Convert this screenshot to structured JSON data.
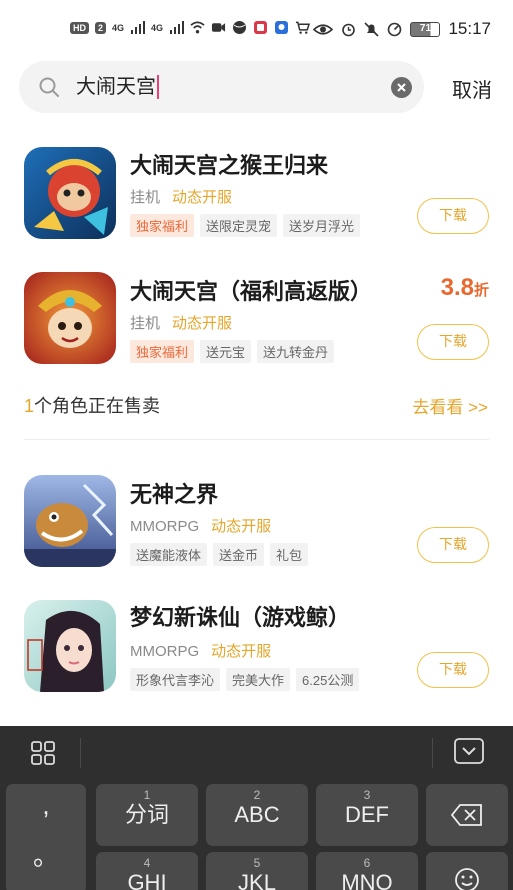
{
  "status_bar": {
    "hd_badge": "HD",
    "sim1": "2",
    "net1": "4G",
    "net2": "4G",
    "battery": "71",
    "time": "15:17"
  },
  "search": {
    "query": "大闹天宫",
    "cancel_label": "取消"
  },
  "apps": [
    {
      "title": "大闹天宫之猴王归来",
      "category": "挂机",
      "open_status": "动态开服",
      "tags": [
        {
          "text": "独家福利",
          "hot": true
        },
        {
          "text": "送限定灵宠",
          "hot": false
        },
        {
          "text": "送岁月浮光",
          "hot": false
        }
      ],
      "download_label": "下载",
      "discount_num": "",
      "discount_unit": ""
    },
    {
      "title": "大闹天宫（福利高返版）",
      "category": "挂机",
      "open_status": "动态开服",
      "tags": [
        {
          "text": "独家福利",
          "hot": true
        },
        {
          "text": "送元宝",
          "hot": false
        },
        {
          "text": "送九转金丹",
          "hot": false
        }
      ],
      "download_label": "下载",
      "discount_num": "3.8",
      "discount_unit": "折"
    },
    {
      "title": "无神之界",
      "category": "MMORPG",
      "open_status": "动态开服",
      "tags": [
        {
          "text": "送魔能液体",
          "hot": false
        },
        {
          "text": "送金币",
          "hot": false
        },
        {
          "text": "礼包",
          "hot": false
        }
      ],
      "download_label": "下载",
      "discount_num": "",
      "discount_unit": ""
    },
    {
      "title": "梦幻新诛仙（游戏鲸）",
      "category": "MMORPG",
      "open_status": "动态开服",
      "tags": [
        {
          "text": "形象代言李沁",
          "hot": false
        },
        {
          "text": "完美大作",
          "hot": false
        },
        {
          "text": "6.25公测",
          "hot": false
        }
      ],
      "download_label": "下载",
      "discount_num": "",
      "discount_unit": ""
    }
  ],
  "role_sale": {
    "count": "1",
    "text": "个角色正在售卖",
    "link": "去看看 >>"
  },
  "keyboard": {
    "punct": [
      ",",
      "。"
    ],
    "row1": [
      {
        "num": "1",
        "label": "分词"
      },
      {
        "num": "2",
        "label": "ABC"
      },
      {
        "num": "3",
        "label": "DEF"
      }
    ],
    "row2": [
      {
        "num": "4",
        "label": "GHI"
      },
      {
        "num": "5",
        "label": "JKL"
      },
      {
        "num": "6",
        "label": "MNO"
      }
    ]
  },
  "colors": {
    "accent": "#e7a52a",
    "discount": "#e8692f",
    "hot_tag": "#ea6a3b",
    "keyboard_bg": "#2f2f2f"
  }
}
